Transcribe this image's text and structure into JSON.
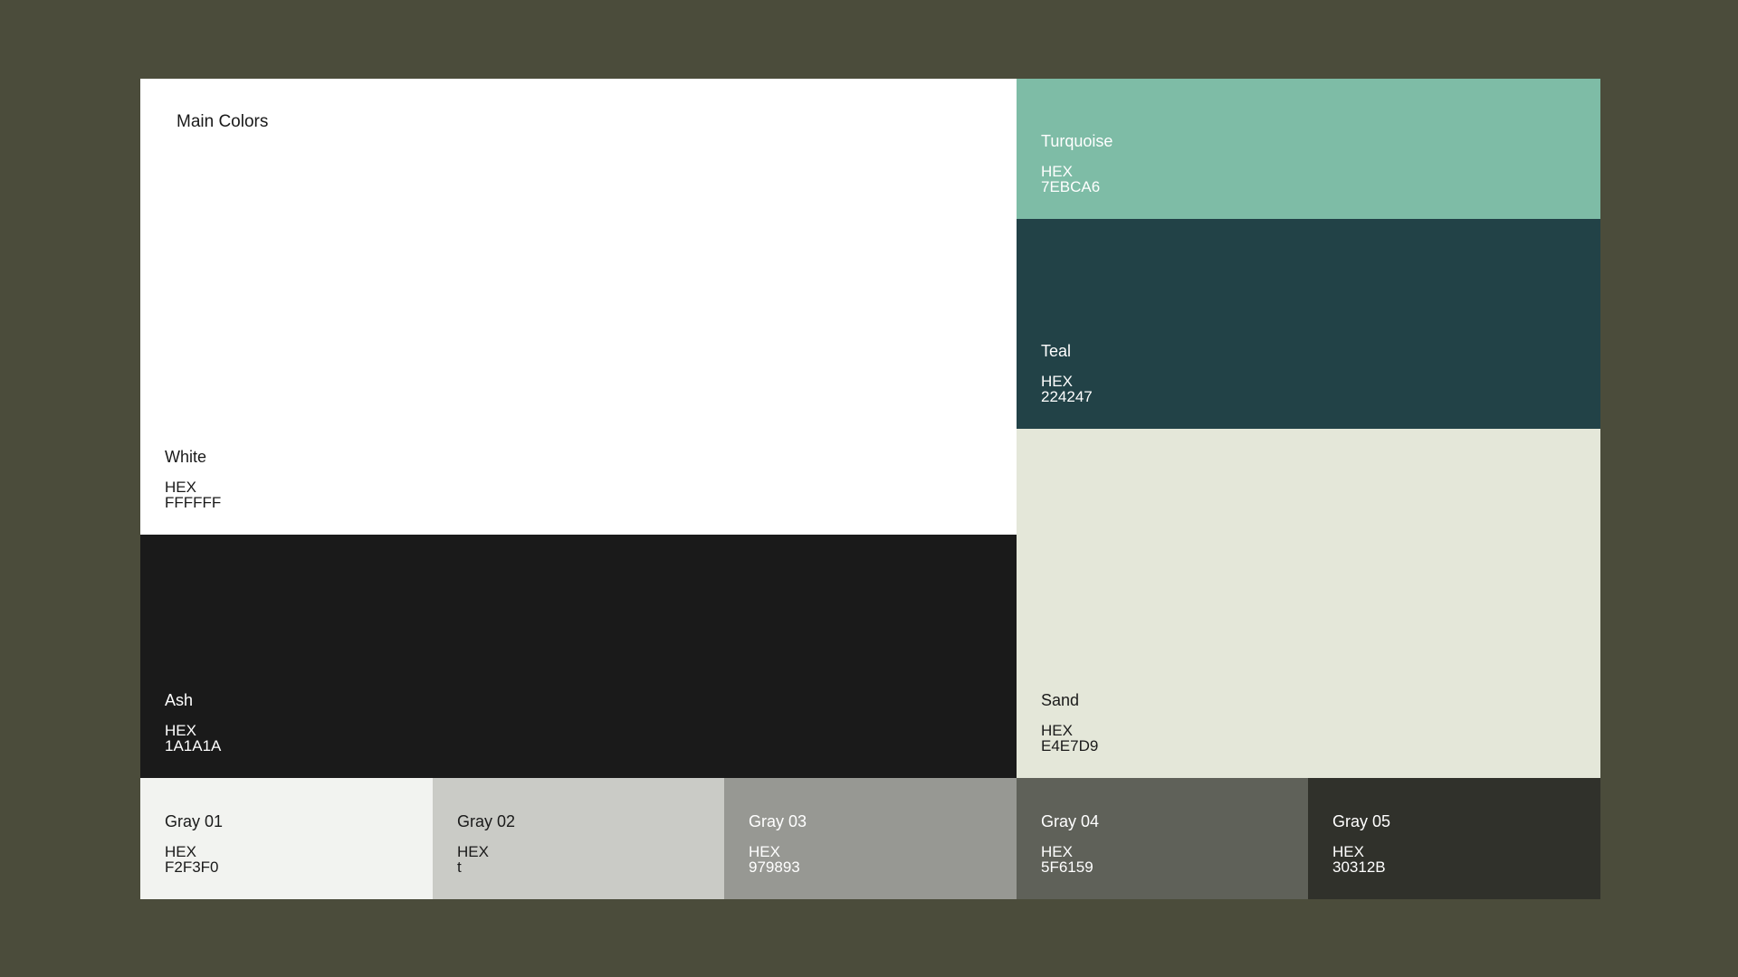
{
  "section_title": "Main Colors",
  "hex_label": "HEX",
  "colors": {
    "white": {
      "name": "White",
      "hex": "FFFFFF",
      "swatch": "#FFFFFF"
    },
    "ash": {
      "name": "Ash",
      "hex": "1A1A1A",
      "swatch": "#1A1A1A"
    },
    "turquoise": {
      "name": "Turquoise",
      "hex": "7EBCA6",
      "swatch": "#7EBCA6"
    },
    "teal": {
      "name": "Teal",
      "hex": "224247",
      "swatch": "#224247"
    },
    "sand": {
      "name": "Sand",
      "hex": "E4E7D9",
      "swatch": "#E4E7D9"
    }
  },
  "grays": [
    {
      "name": "Gray 01",
      "hex": "F2F3F0",
      "swatch": "#F2F3F0"
    },
    {
      "name": "Gray 02",
      "hex": "t",
      "swatch": "#CACBC6"
    },
    {
      "name": "Gray 03",
      "hex": "979893",
      "swatch": "#979893"
    },
    {
      "name": "Gray 04",
      "hex": "5F6159",
      "swatch": "#5F6159"
    },
    {
      "name": "Gray 05",
      "hex": "30312B",
      "swatch": "#30312B"
    }
  ],
  "page_background": "#4B4C3B"
}
